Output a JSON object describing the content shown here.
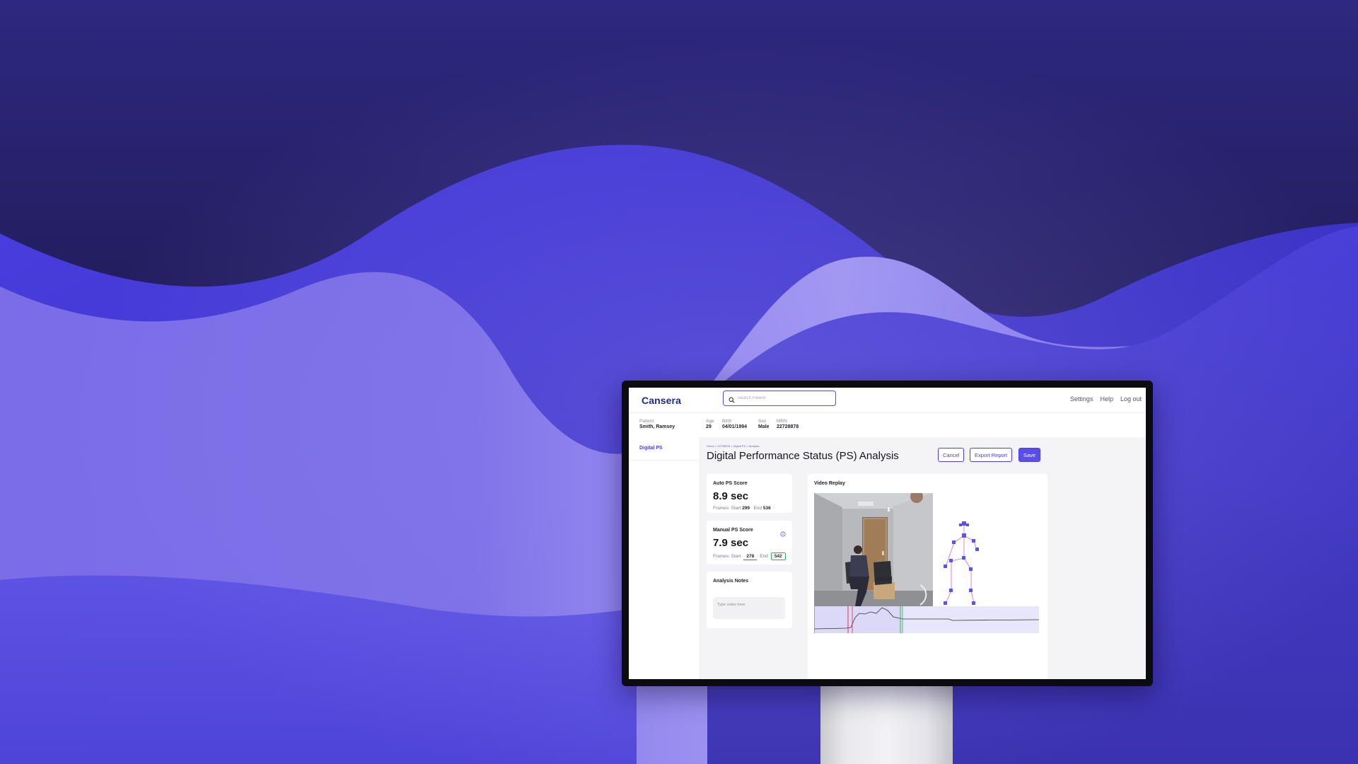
{
  "app": {
    "logo": "Cansera",
    "search_placeholder": "Search Patient",
    "nav": [
      "Settings",
      "Help",
      "Log out"
    ]
  },
  "patient": {
    "patient_label": "Patient",
    "name": "Smith, Ramsey",
    "age_label": "Age",
    "age": "29",
    "birth_label": "Birth",
    "birth": "04/01/1994",
    "sex_label": "Sex",
    "sex": "Male",
    "mrn_label": "MRN",
    "mrn": "22728878"
  },
  "sidebar": {
    "items": [
      "Digital PS"
    ]
  },
  "page": {
    "breadcrumb": "Home > 22728878 > Digital PS > Analysis",
    "title": "Digital Performance Status (PS) Analysis",
    "buttons": {
      "cancel": "Cancel",
      "export": "Export Report",
      "save": "Save"
    }
  },
  "auto_score": {
    "title": "Auto PS Score",
    "value": "8.9 sec",
    "frames_label": "Frames: Start",
    "start": "299",
    "end_label": "End",
    "end": "536"
  },
  "manual_score": {
    "title": "Manual PS Score",
    "value": "7.9 sec",
    "frames_label": "Frames: Start",
    "start": "278",
    "end_label": "End",
    "end": "542"
  },
  "notes": {
    "title": "Analysis Notes",
    "placeholder": "Type notes here"
  },
  "video": {
    "title": "Video Replay"
  },
  "colors": {
    "accent": "#5a4ee6",
    "brand": "#1f2a8c",
    "start_marker": "#e0344a",
    "end_marker": "#2fb35a"
  }
}
